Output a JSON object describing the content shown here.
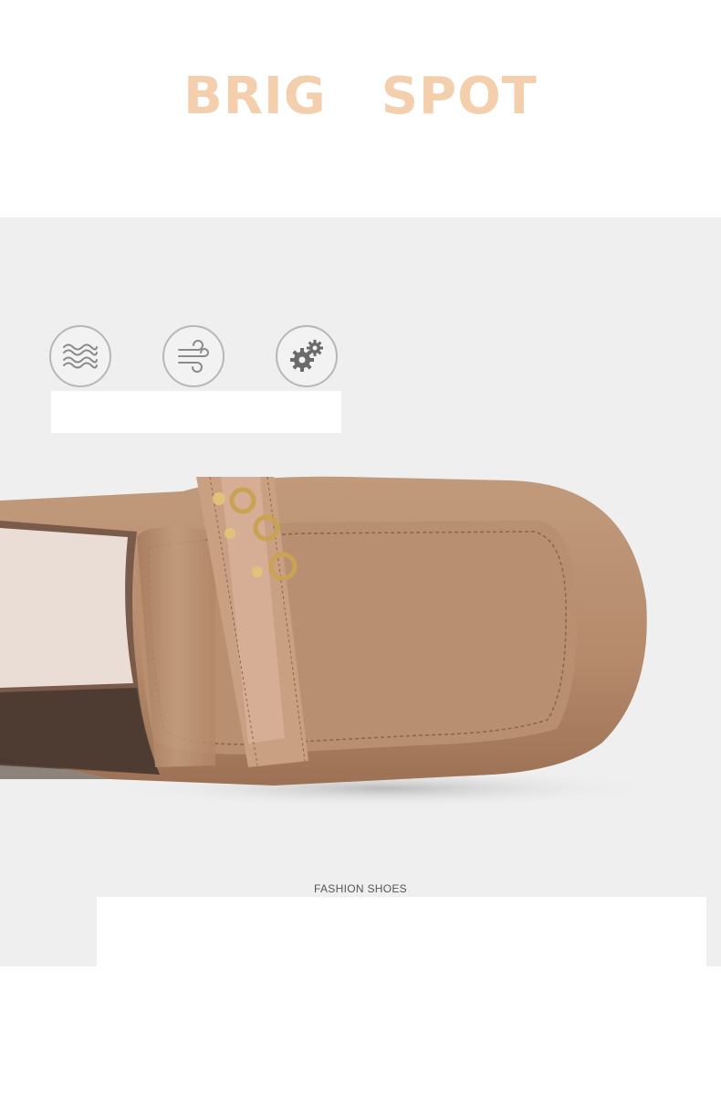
{
  "header": {
    "title_part1": "BRIG",
    "title_part2": "SPOT"
  },
  "features": [
    {
      "icon": "waves-icon"
    },
    {
      "icon": "wind-icon"
    },
    {
      "icon": "gears-icon"
    }
  ],
  "product": {
    "caption": "FASHION SHOES"
  },
  "colors": {
    "title": "#f3cfae",
    "leather": "#b68b6d",
    "panel": "#efefef"
  }
}
